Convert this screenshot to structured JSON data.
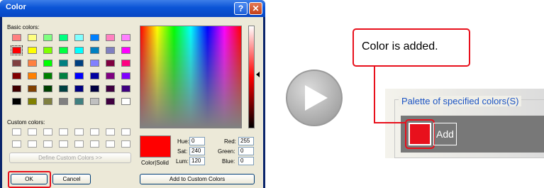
{
  "dialog": {
    "title": "Color",
    "help_glyph": "?",
    "close_glyph": "✕",
    "basic_colors_label": "Basic colors:",
    "custom_colors_label": "Custom colors:",
    "basic_colors": [
      [
        "#ff8080",
        "#ffff80",
        "#80ff80",
        "#00ff80",
        "#80ffff",
        "#0080ff",
        "#ff80c0",
        "#ff80ff"
      ],
      [
        "#ff0000",
        "#ffff00",
        "#80ff00",
        "#00ff40",
        "#00ffff",
        "#0080c0",
        "#8080c0",
        "#ff00ff"
      ],
      [
        "#804040",
        "#ff8040",
        "#00ff00",
        "#008080",
        "#004080",
        "#8080ff",
        "#800040",
        "#ff0080"
      ],
      [
        "#800000",
        "#ff8000",
        "#008000",
        "#008040",
        "#0000ff",
        "#0000a0",
        "#800080",
        "#8000ff"
      ],
      [
        "#400000",
        "#804000",
        "#004000",
        "#004040",
        "#000080",
        "#000040",
        "#400040",
        "#400080"
      ],
      [
        "#000000",
        "#808000",
        "#808040",
        "#808080",
        "#408080",
        "#c0c0c0",
        "#400040",
        "#ffffff"
      ]
    ],
    "selected_basic_color": "#ff0000",
    "define_custom_colors_button": "Define Custom Colors >>",
    "ok_button": "OK",
    "cancel_button": "Cancel",
    "add_to_custom_colors_button": "Add to Custom Colors",
    "color_solid_label": "Color|Solid",
    "preview_color": "#ff0000",
    "hue_label": "Hue:",
    "hue_value": "0",
    "sat_label": "Sat:",
    "sat_value": "240",
    "lum_label": "Lum:",
    "lum_value": "120",
    "red_label": "Red:",
    "red_value": "255",
    "green_label": "Green:",
    "green_value": "0",
    "blue_label": "Blue:",
    "blue_value": "0"
  },
  "play_icon": "play-icon",
  "callout": {
    "text": "Color is added."
  },
  "zoom": {
    "palette_title": "Palette of specified colors(S)",
    "added_color": "#e8101c",
    "add_button": "Add"
  },
  "colors": {
    "highlight": "#e8101c",
    "title_link": "#1c54c4"
  }
}
